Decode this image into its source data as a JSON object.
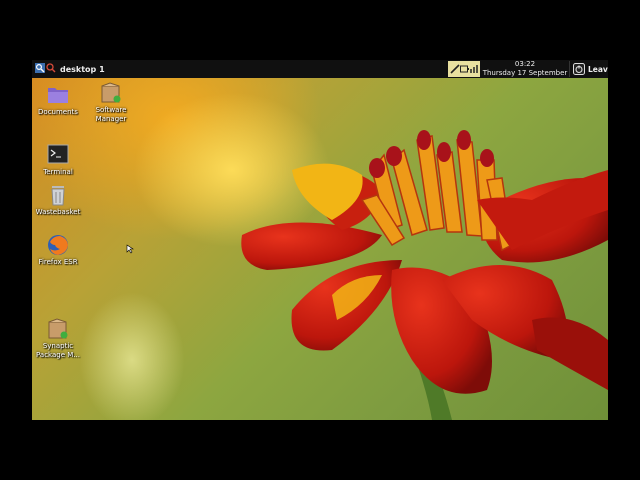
{
  "taskbar": {
    "desktop_label": "desktop 1",
    "time": "03:22",
    "date": "Thursday 17 September",
    "leave_label": "Leave"
  },
  "desktop_icons": [
    {
      "label": "Documents",
      "icon": "folder-icon"
    },
    {
      "label": "Software Manager",
      "icon": "package-icon"
    },
    {
      "label": "Terminal",
      "icon": "terminal-icon"
    },
    {
      "label": "Wastebasket",
      "icon": "trash-icon"
    },
    {
      "label": "Firefox ESR",
      "icon": "firefox-icon"
    },
    {
      "label": "Synaptic Package M...",
      "icon": "package-icon"
    }
  ],
  "colors": {
    "taskbar": "#101010",
    "tray": "#e9e0a0",
    "petal_red": "#c31a0e",
    "petal_yellow": "#f2b515"
  }
}
